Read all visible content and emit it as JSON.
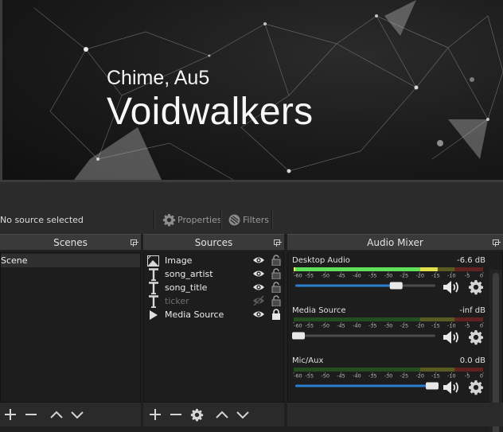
{
  "preview": {
    "artist": "Chime, Au5",
    "title": "Voidwalkers"
  },
  "toolbar": {
    "no_source": "No source selected",
    "properties_label": "Properties",
    "filters_label": "Filters"
  },
  "scenes": {
    "title": "Scenes",
    "items": [
      {
        "label": "Scene",
        "selected": true
      }
    ]
  },
  "sources": {
    "title": "Sources",
    "items": [
      {
        "label": "Image",
        "icon": "image-icon",
        "visible": true,
        "locked": false
      },
      {
        "label": "song_artist",
        "icon": "text-icon",
        "visible": true,
        "locked": false
      },
      {
        "label": "song_title",
        "icon": "text-icon",
        "visible": true,
        "locked": false
      },
      {
        "label": "ticker",
        "icon": "text-icon",
        "visible": false,
        "locked": false
      },
      {
        "label": "Media Source",
        "icon": "play-icon",
        "visible": true,
        "locked": true
      }
    ]
  },
  "mixer": {
    "title": "Audio Mixer",
    "scale_labels": [
      "-60",
      "-55",
      "-50",
      "-45",
      "-40",
      "-35",
      "-30",
      "-25",
      "-20",
      "-15",
      "-10",
      "-5",
      "0"
    ],
    "channels": [
      {
        "name": "Desktop Audio",
        "db": "-6.6 dB",
        "level": 0.95,
        "volume": 0.72
      },
      {
        "name": "Media Source",
        "db": "-inf dB",
        "level": 0,
        "volume": 0.02
      },
      {
        "name": "Mic/Aux",
        "db": "0.0 dB",
        "level": 0,
        "volume": 1.0
      }
    ]
  },
  "colors": {
    "meter_green": "#32a72c",
    "meter_yellow": "#a3a32b",
    "meter_red": "#a52626",
    "slider_blue": "#2b7fd0"
  }
}
